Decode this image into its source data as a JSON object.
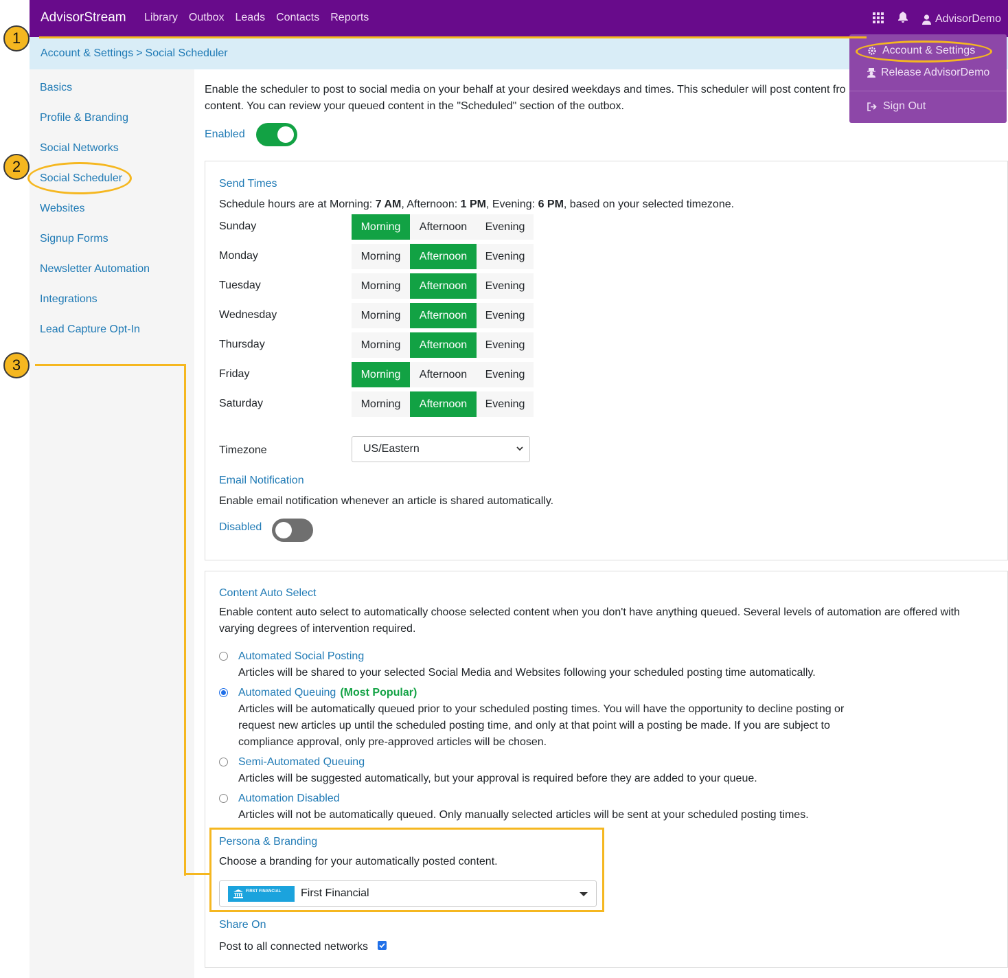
{
  "nav": {
    "brand": "AdvisorStream",
    "links": [
      "Library",
      "Outbox",
      "Leads",
      "Contacts",
      "Reports"
    ],
    "user": "AdvisorDemo"
  },
  "dropdown": {
    "account_settings": "Account & Settings",
    "release": "Release AdvisorDemo",
    "sign_out": "Sign Out"
  },
  "breadcrumb": {
    "parent": "Account & Settings",
    "separator": ">",
    "current": "Social Scheduler"
  },
  "sidebar": {
    "items": [
      {
        "label": "Basics"
      },
      {
        "label": "Profile & Branding"
      },
      {
        "label": "Social Networks"
      },
      {
        "label": "Social Scheduler"
      },
      {
        "label": "Websites"
      },
      {
        "label": "Signup Forms"
      },
      {
        "label": "Newsletter Automation"
      },
      {
        "label": "Integrations"
      },
      {
        "label": "Lead Capture Opt-In"
      }
    ]
  },
  "main": {
    "intro": "Enable the scheduler to post to social media on your behalf at your desired weekdays and times. This scheduler will post content fro content. You can review your queued content in the \"Scheduled\" section of the outbox.",
    "enabled_label": "Enabled",
    "enabled": true
  },
  "send_times": {
    "title": "Send Times",
    "desc_pre": "Schedule hours are at Morning: ",
    "morning_time": "7 AM",
    "desc_mid1": ", Afternoon: ",
    "afternoon_time": "1 PM",
    "desc_mid2": ", Evening: ",
    "evening_time": "6 PM",
    "desc_post": ", based on your selected timezone.",
    "slot_labels": {
      "morning": "Morning",
      "afternoon": "Afternoon",
      "evening": "Evening"
    },
    "days": [
      {
        "name": "Sunday",
        "selected": "morning"
      },
      {
        "name": "Monday",
        "selected": "afternoon"
      },
      {
        "name": "Tuesday",
        "selected": "afternoon"
      },
      {
        "name": "Wednesday",
        "selected": "afternoon"
      },
      {
        "name": "Thursday",
        "selected": "afternoon"
      },
      {
        "name": "Friday",
        "selected": "morning"
      },
      {
        "name": "Saturday",
        "selected": "afternoon"
      }
    ],
    "timezone_label": "Timezone",
    "timezone_value": "US/Eastern"
  },
  "email_notification": {
    "title": "Email Notification",
    "desc": "Enable email notification whenever an article is shared automatically.",
    "state_label": "Disabled",
    "enabled": false
  },
  "content_auto_select": {
    "title": "Content Auto Select",
    "desc": "Enable content auto select to automatically choose selected content when you don't have anything queued. Several levels of automation are offered with varying degrees of intervention required.",
    "options": [
      {
        "title": "Automated Social Posting",
        "desc": "Articles will be shared to your selected Social Media and Websites following your scheduled posting time automatically.",
        "checked": false
      },
      {
        "title": "Automated Queuing",
        "badge": "(Most Popular)",
        "desc": "Articles will be automatically queued prior to your scheduled posting times. You will have the opportunity to decline posting or request new articles up until the scheduled posting time, and only at that point will a posting be made. If you are subject to compliance approval, only pre-approved articles will be chosen.",
        "checked": true
      },
      {
        "title": "Semi-Automated Queuing",
        "desc": "Articles will be suggested automatically, but your approval is required before they are added to your queue.",
        "checked": false
      },
      {
        "title": "Automation Disabled",
        "desc": "Articles will not be automatically queued. Only manually selected articles will be sent at your scheduled posting times.",
        "checked": false
      }
    ]
  },
  "persona": {
    "title": "Persona & Branding",
    "desc": "Choose a branding for your automatically posted content.",
    "logo_text": "FIRST FINANCIAL",
    "selected": "First Financial"
  },
  "share_on": {
    "title": "Share On",
    "label": "Post to all connected networks",
    "checked": true
  },
  "annotations": {
    "badges": [
      "1",
      "2",
      "3"
    ],
    "color": "#f5b720"
  },
  "colors": {
    "nav_bg": "#680b8b",
    "accent": "#1f7ab5",
    "selected_green": "#12a244",
    "breadcrumb_bg": "#d9edf7"
  }
}
